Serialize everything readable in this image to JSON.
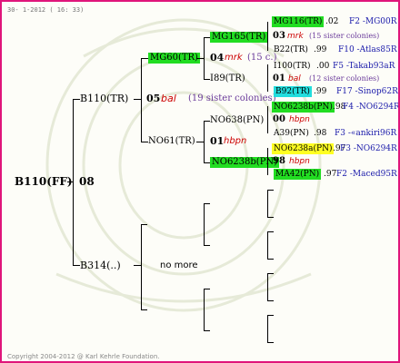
{
  "header": {
    "date": "30- 1-2012 ( 16: 33)"
  },
  "footer": {
    "copyright": "Copyright 2004-2012 @ Karl Kehrle Foundation."
  },
  "root": {
    "queen": "B110(FF)",
    "year": "08"
  },
  "father": {
    "name": "B110(TR)",
    "year": "05",
    "breeder": "bal",
    "note": "(19 sister colonies)"
  },
  "grandfather_top": {
    "name": "MG60(TR)",
    "ggf": "MG165(TR)",
    "ggm": "I89(TR)",
    "mid_year": "04",
    "mid_breeder": "mrk",
    "mid_note": "(15 c.)"
  },
  "grandmother_top": {
    "name": "NO61(TR)",
    "ggf": "NO638(PN)",
    "ggm": "NO6238b(PN)",
    "mid_year": "01",
    "mid_breeder": "hbpn"
  },
  "mother": {
    "name": "B314(..)",
    "note": "no more"
  },
  "right": [
    {
      "name": "MG116(TR)",
      "year": ".02",
      "link": "F2 -MG00R"
    },
    {
      "year": "03",
      "breeder": "mrk",
      "note": "(15 sister colonies)"
    },
    {
      "name": "B22(TR)",
      "year": ".99",
      "link": "F10 -Atlas85R"
    },
    {
      "name": "I100(TR)",
      "year": ".00",
      "link": "F5 -Takab93aR"
    },
    {
      "year": "01",
      "breeder": "bal",
      "note": "(12 sister colonies)"
    },
    {
      "name": "B92(TR)",
      "year": ".99",
      "link": "F17 -Sinop62R"
    },
    {
      "name": "NO6238b(PN)",
      "year": ".98",
      "link": "F4 -NO6294R"
    },
    {
      "year": "00",
      "breeder": "hbpn"
    },
    {
      "name": "A39(PN)",
      "year": ".98",
      "link": "F3 -«ankiri96R"
    },
    {
      "name": "NO6238a(PN)",
      "year": ".97",
      "link": "F3 -NO6294R"
    },
    {
      "year": "98",
      "breeder": "hbpn"
    },
    {
      "name": "MA42(PN)",
      "year": ".97",
      "link": "F2 -Maced95R"
    }
  ]
}
